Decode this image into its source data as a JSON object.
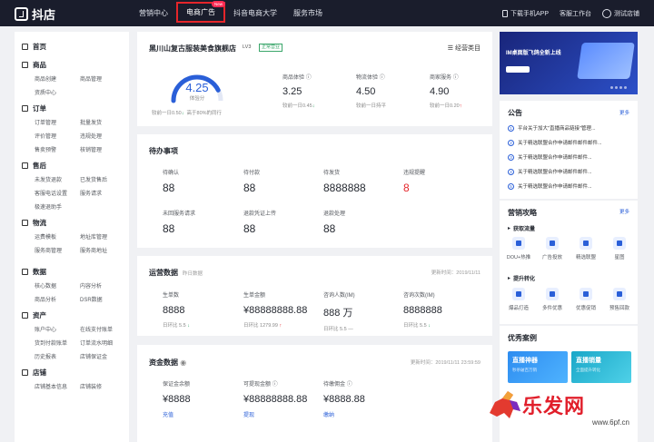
{
  "topbar": {
    "logo": "抖店",
    "nav": [
      "营销中心",
      "电商广告",
      "抖音电商大学",
      "服务市场"
    ],
    "badge": "New",
    "download": "下载手机APP",
    "workbench": "客服工作台",
    "user": "测试店铺"
  },
  "sidebar": {
    "home": "首页",
    "groups": [
      {
        "title": "商品",
        "items": [
          "商品创建",
          "商品管理",
          "资质中心"
        ]
      },
      {
        "title": "订单",
        "items": [
          "订单管理",
          "批量发货",
          "评价管理",
          "违规处理",
          "售卖预警",
          "核销管理"
        ]
      },
      {
        "title": "售后",
        "items": [
          "未发货退款",
          "已发货售后",
          "客服电话设置",
          "服务请求",
          "极速退助手"
        ]
      },
      {
        "title": "物流",
        "items": [
          "运费模板",
          "地址库管理",
          "服务商管理",
          "服务商地址"
        ]
      },
      {
        "title": "数据",
        "items": [
          "核心数据",
          "内容分析",
          "商品分析",
          "DSR数据"
        ]
      },
      {
        "title": "资产",
        "items": [
          "账户中心",
          "在线支付账单",
          "货到付款账单",
          "订单流水明细",
          "历史报表",
          "店铺保证金"
        ]
      },
      {
        "title": "店铺",
        "items": [
          "店铺基本信息",
          "店铺装修"
        ]
      }
    ]
  },
  "shop": {
    "name": "黑川山复古服装美食旗舰店",
    "level": "LV3",
    "status": "正常营业",
    "category": "经营类目",
    "score": "4.25",
    "score_label": "体验分",
    "score_sub": "较前一日0.50",
    "beat": "高于80%的同行",
    "metrics": [
      {
        "label": "商品体验",
        "value": "3.25",
        "sub": "较前一日0.45",
        "trend": "down"
      },
      {
        "label": "物流体验",
        "value": "4.50",
        "sub": "较前一日持平",
        "trend": "flat"
      },
      {
        "label": "商家服务",
        "value": "4.90",
        "sub": "较前一日0.20",
        "trend": "up"
      }
    ]
  },
  "todo": {
    "title": "待办事项",
    "items": [
      {
        "label": "待确认",
        "value": "88"
      },
      {
        "label": "待付款",
        "value": "88"
      },
      {
        "label": "待发货",
        "value": "8888888"
      },
      {
        "label": "违规提醒",
        "value": "8"
      },
      {
        "label": "未回服务请求",
        "value": "88"
      },
      {
        "label": "退款凭证上传",
        "value": "88"
      },
      {
        "label": "退款处理",
        "value": "88"
      }
    ]
  },
  "ops": {
    "title": "运营数据",
    "note": "昨日数据",
    "date": "更新时间：2019/11/11",
    "items": [
      {
        "label": "生单数",
        "value": "8888",
        "sub": "日环比 5.5",
        "trend": "down"
      },
      {
        "label": "生单金额",
        "value": "¥88888888.88",
        "sub": "日环比 1279.99",
        "trend": "up"
      },
      {
        "label": "咨询人数(IM)",
        "value": "888 万",
        "sub": "日环比 5.5",
        "trend": "flat"
      },
      {
        "label": "咨询次数(IM)",
        "value": "8888888",
        "sub": "日环比 5.5",
        "trend": "down"
      }
    ]
  },
  "funds": {
    "title": "资金数据",
    "date": "更新时间：2019/11/11 23:59:59",
    "items": [
      {
        "label": "保证金余额",
        "value": "¥8888",
        "link": "充值"
      },
      {
        "label": "可提现金额",
        "value": "¥88888888.88",
        "link": "提现"
      },
      {
        "label": "待缴佣金",
        "value": "¥8888.88",
        "link": "缴纳"
      }
    ]
  },
  "banner": {
    "text": "IM桌面版飞鸽全新上线"
  },
  "announce": {
    "title": "公告",
    "more": "更多",
    "items": [
      "平台关于加大\"直播商品链接\"管理...",
      "关于精选联盟合作申请邮件邮件邮件...",
      "关于精选联盟合作申请邮件邮件...",
      "关于精选联盟合作申请邮件邮件...",
      "关于精选联盟合作申请邮件邮件..."
    ]
  },
  "guide": {
    "title": "营销攻略",
    "more": "更多",
    "sub1": "获取流量",
    "tools1": [
      "DOU+热推",
      "广告投放",
      "精选联盟",
      "星图"
    ],
    "sub2": "提升转化",
    "tools2": [
      "爆品打造",
      "多件优惠",
      "优惠促销",
      "预售回款"
    ]
  },
  "cases": {
    "title": "优秀案例",
    "items": [
      {
        "name": "直播神器",
        "desc": "秒杀破百万销"
      },
      {
        "name": "直播销量",
        "desc": "全面提升转化"
      }
    ]
  },
  "watermark": {
    "text": "乐发网",
    "url": "www.6pf.cn"
  },
  "colors": {
    "accent": "#2a5fd8",
    "topbar": "#1a1d2c",
    "alert": "#e5252a"
  }
}
